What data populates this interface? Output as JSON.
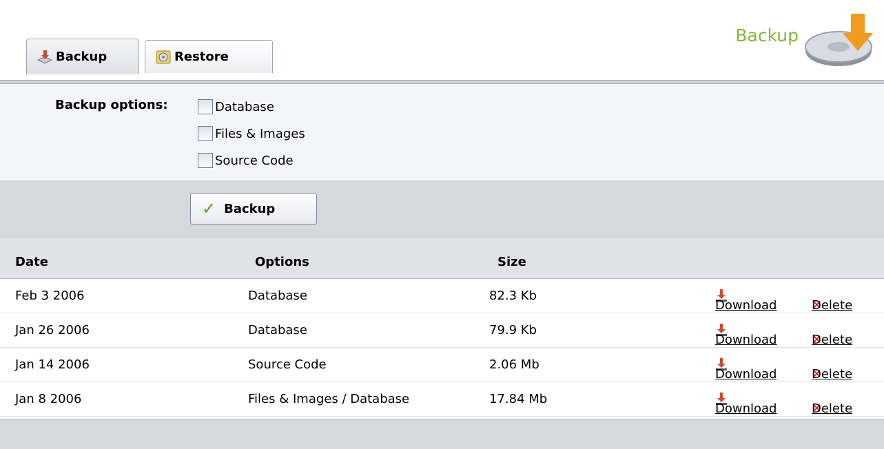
{
  "header": {
    "title": "Backup",
    "logo_icon": "hard-drive-download-icon"
  },
  "tabs": [
    {
      "label": "Backup",
      "icon": "download-tray-icon",
      "active": true
    },
    {
      "label": "Restore",
      "icon": "restore-disc-icon",
      "active": false
    }
  ],
  "options": {
    "label": "Backup options:",
    "items": [
      {
        "label": "Database",
        "checked": false
      },
      {
        "label": "Files & Images",
        "checked": false
      },
      {
        "label": "Source Code",
        "checked": false
      }
    ]
  },
  "backup_button": {
    "label": "Backup",
    "icon": "checkmark-icon"
  },
  "table": {
    "headers": {
      "date": "Date",
      "options": "Options",
      "size": "Size"
    },
    "rows": [
      {
        "date": "Feb 3 2006",
        "options": "Database",
        "size": "82.3 Kb",
        "download": "Download",
        "delete": "Delete"
      },
      {
        "date": "Jan 26 2006",
        "options": "Database",
        "size": "79.9 Kb",
        "download": "Download",
        "delete": "Delete"
      },
      {
        "date": "Jan 14 2006",
        "options": "Source Code",
        "size": "2.06 Mb",
        "download": "Download",
        "delete": "Delete"
      },
      {
        "date": "Jan 8 2006",
        "options": "Files & Images / Database",
        "size": "17.84 Mb",
        "download": "Download",
        "delete": "Delete"
      }
    ]
  },
  "colors": {
    "accent_green": "#7fb73a",
    "delete_red": "#e01616",
    "panel_gray": "#d7d8de"
  }
}
